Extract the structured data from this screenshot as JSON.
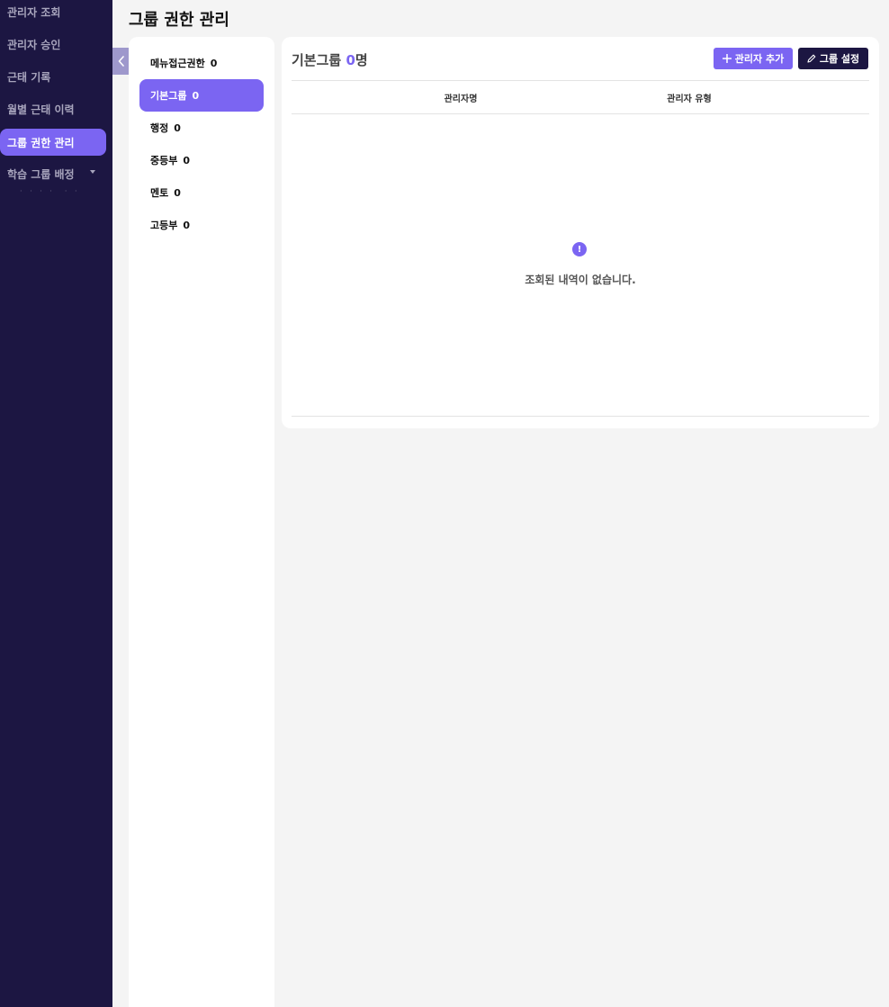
{
  "sidebar": {
    "items": [
      {
        "label": "관리자 조회"
      },
      {
        "label": "관리자 승인"
      },
      {
        "label": "근태 기록"
      },
      {
        "label": "월별 근태 이력"
      },
      {
        "label": "그룹 권한 관리",
        "active": true
      },
      {
        "label": "학습 그룹 배정",
        "has_submenu": true
      }
    ]
  },
  "page": {
    "title": "그룹 권한 관리"
  },
  "groups": {
    "items": [
      {
        "name": "메뉴접근권한",
        "count": "0"
      },
      {
        "name": "기본그룹",
        "count": "0",
        "active": true
      },
      {
        "name": "행정",
        "count": "0"
      },
      {
        "name": "중등부",
        "count": "0"
      },
      {
        "name": "멘토",
        "count": "0"
      },
      {
        "name": "고등부",
        "count": "0"
      }
    ]
  },
  "main": {
    "group_name": "기본그룹",
    "member_count": "0",
    "count_unit": "명",
    "add_button_label": "관리자 추가",
    "settings_button_label": "그룹 설정",
    "columns": [
      "관리자명",
      "관리자 유형"
    ],
    "empty_icon": "!",
    "empty_message": "조회된 내역이 없습니다."
  },
  "icons": {
    "collapse": "chevron-left-icon",
    "add": "plus-icon",
    "settings": "pencil-icon",
    "empty": "info-icon"
  },
  "colors": {
    "sidebar_bg": "#1c1642",
    "accent": "#7b65f2",
    "dark_button": "#1c1642",
    "page_bg": "#f4f4f4"
  }
}
